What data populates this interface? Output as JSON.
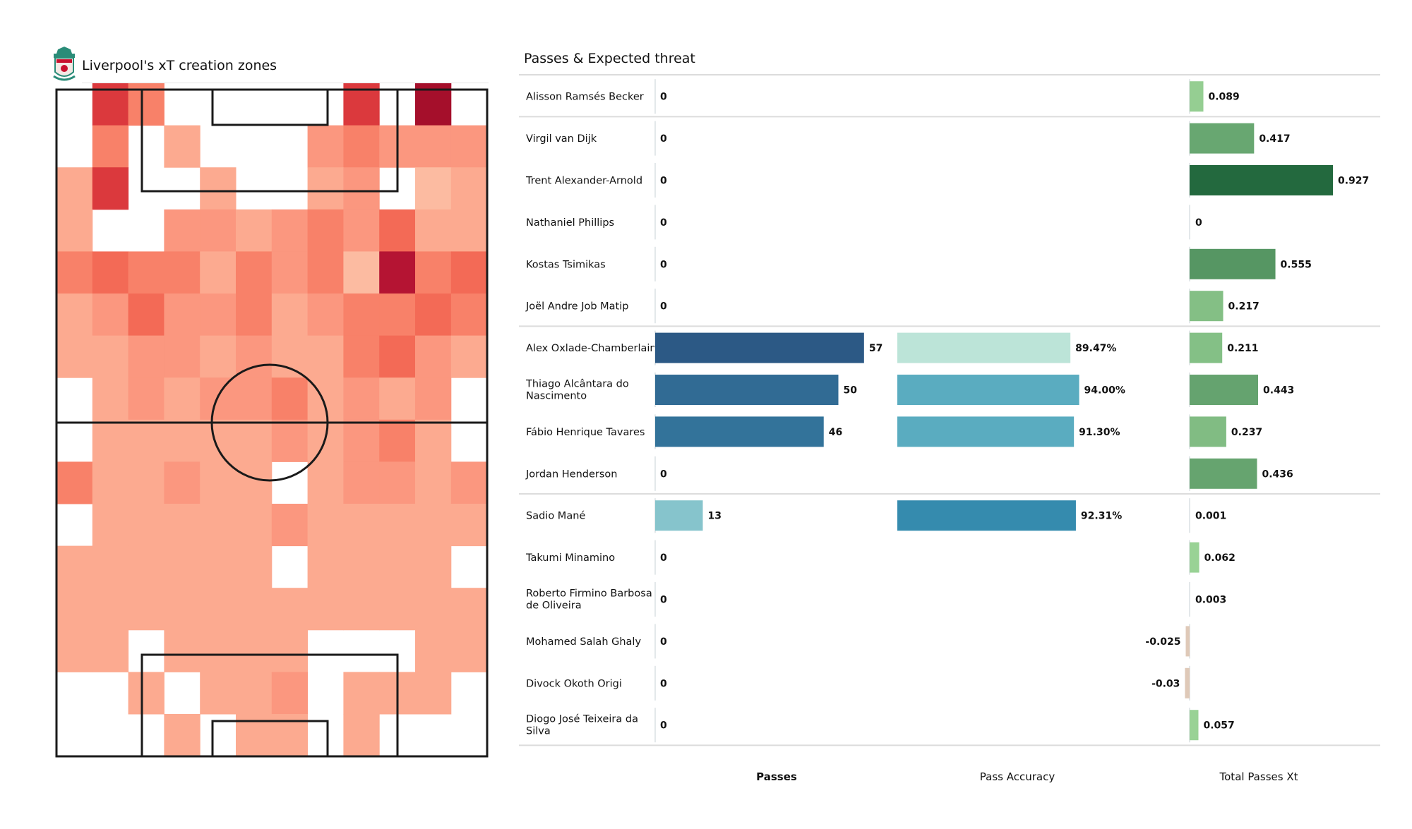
{
  "left": {
    "title": "Liverpool's xT creation zones",
    "logo": "liverpool-crest-icon"
  },
  "right": {
    "title": "Passes & Expected threat",
    "columns": {
      "passes": "Passes",
      "pass_accuracy": "Pass Accuracy",
      "total_xt": "Total Passes Xt"
    }
  },
  "colors": {
    "heat_low": "#fcbba1",
    "heat_high": "#a50f2b",
    "passes_bar_scale": [
      "#86c4cc",
      "#2c5985"
    ],
    "xt_positive_scale": [
      "#a1d99b",
      "#23693e"
    ],
    "xt_negative": "#dfc9b8",
    "separator": "#dcdcdc"
  },
  "chart_data": [
    {
      "type": "heatmap",
      "title": "Liverpool's xT creation zones",
      "description": "Pitch divided into 16 rows (top = attacking goal) x 12 columns; intensity 0 (none) to 10 (highest xT)",
      "rows": 16,
      "cols": 12,
      "values": [
        [
          0,
          7,
          4,
          0,
          0,
          0,
          0,
          0,
          7,
          0,
          10,
          0
        ],
        [
          0,
          4,
          0,
          2,
          0,
          0,
          0,
          3,
          4,
          3,
          3,
          3
        ],
        [
          2,
          7,
          0,
          0,
          2,
          0,
          0,
          2,
          3,
          0,
          1,
          2
        ],
        [
          2,
          0,
          0,
          3,
          3,
          2,
          3,
          4,
          3,
          5,
          2,
          2
        ],
        [
          4,
          5,
          4,
          4,
          2,
          4,
          3,
          4,
          1,
          9,
          4,
          5
        ],
        [
          2,
          3,
          5,
          3,
          3,
          4,
          2,
          3,
          4,
          4,
          5,
          4
        ],
        [
          2,
          2,
          3,
          3,
          2,
          3,
          2,
          2,
          4,
          5,
          3,
          2
        ],
        [
          0,
          2,
          3,
          2,
          3,
          3,
          4,
          2,
          3,
          2,
          3,
          0
        ],
        [
          0,
          2,
          2,
          2,
          2,
          2,
          3,
          2,
          3,
          4,
          2,
          0
        ],
        [
          4,
          2,
          2,
          3,
          2,
          2,
          0,
          2,
          3,
          3,
          2,
          3
        ],
        [
          0,
          2,
          2,
          2,
          2,
          2,
          3,
          2,
          2,
          2,
          2,
          2
        ],
        [
          2,
          2,
          2,
          2,
          2,
          2,
          0,
          2,
          2,
          2,
          2,
          0
        ],
        [
          2,
          2,
          2,
          2,
          2,
          2,
          2,
          2,
          2,
          2,
          2,
          2
        ],
        [
          2,
          2,
          0,
          2,
          2,
          2,
          2,
          0,
          0,
          0,
          2,
          2
        ],
        [
          0,
          0,
          2,
          0,
          2,
          2,
          3,
          0,
          2,
          2,
          2,
          0
        ],
        [
          0,
          0,
          0,
          2,
          0,
          2,
          2,
          0,
          2,
          0,
          0,
          0
        ]
      ]
    },
    {
      "type": "table",
      "title": "Passes & Expected threat",
      "columns": [
        "Player",
        "Passes",
        "Pass Accuracy",
        "Total Passes Xt"
      ],
      "groups": [
        {
          "rows": [
            {
              "player": "Alisson Ramsés Becker",
              "passes": 0,
              "passes_label": "0",
              "accuracy": null,
              "accuracy_label": "",
              "xt": 0.089,
              "xt_label": "0.089"
            }
          ]
        },
        {
          "rows": [
            {
              "player": "Virgil van Dijk",
              "passes": 0,
              "passes_label": "0",
              "accuracy": null,
              "accuracy_label": "",
              "xt": 0.417,
              "xt_label": "0.417"
            },
            {
              "player": "Trent Alexander-Arnold",
              "passes": 0,
              "passes_label": "0",
              "accuracy": null,
              "accuracy_label": "",
              "xt": 0.927,
              "xt_label": "0.927"
            },
            {
              "player": "Nathaniel Phillips",
              "passes": 0,
              "passes_label": "0",
              "accuracy": null,
              "accuracy_label": "",
              "xt": 0,
              "xt_label": "0"
            },
            {
              "player": "Kostas Tsimikas",
              "passes": 0,
              "passes_label": "0",
              "accuracy": null,
              "accuracy_label": "",
              "xt": 0.555,
              "xt_label": "0.555"
            },
            {
              "player": "Joël Andre Job Matip",
              "passes": 0,
              "passes_label": "0",
              "accuracy": null,
              "accuracy_label": "",
              "xt": 0.217,
              "xt_label": "0.217"
            }
          ]
        },
        {
          "rows": [
            {
              "player": "Alex Oxlade-Chamberlain",
              "passes": 57,
              "passes_label": "57",
              "accuracy": 89.47,
              "accuracy_label": "89.47%",
              "xt": 0.211,
              "xt_label": "0.211"
            },
            {
              "player": "Thiago Alcântara do Nascimento",
              "passes": 50,
              "passes_label": "50",
              "accuracy": 94.0,
              "accuracy_label": "94.00%",
              "xt": 0.443,
              "xt_label": "0.443"
            },
            {
              "player": "Fábio Henrique Tavares",
              "passes": 46,
              "passes_label": "46",
              "accuracy": 91.3,
              "accuracy_label": "91.30%",
              "xt": 0.237,
              "xt_label": "0.237"
            },
            {
              "player": "Jordan Henderson",
              "passes": 0,
              "passes_label": "0",
              "accuracy": null,
              "accuracy_label": "",
              "xt": 0.436,
              "xt_label": "0.436"
            }
          ]
        },
        {
          "rows": [
            {
              "player": "Sadio Mané",
              "passes": 13,
              "passes_label": "13",
              "accuracy": 92.31,
              "accuracy_label": "92.31%",
              "xt": 0.001,
              "xt_label": "0.001"
            },
            {
              "player": "Takumi Minamino",
              "passes": 0,
              "passes_label": "0",
              "accuracy": null,
              "accuracy_label": "",
              "xt": 0.062,
              "xt_label": "0.062"
            },
            {
              "player": "Roberto Firmino Barbosa de Oliveira",
              "passes": 0,
              "passes_label": "0",
              "accuracy": null,
              "accuracy_label": "",
              "xt": 0.003,
              "xt_label": "0.003"
            },
            {
              "player": "Mohamed  Salah Ghaly",
              "passes": 0,
              "passes_label": "0",
              "accuracy": null,
              "accuracy_label": "",
              "xt": -0.025,
              "xt_label": "-0.025"
            },
            {
              "player": "Divock Okoth Origi",
              "passes": 0,
              "passes_label": "0",
              "accuracy": null,
              "accuracy_label": "",
              "xt": -0.03,
              "xt_label": "-0.03"
            },
            {
              "player": "Diogo José Teixeira da Silva",
              "passes": 0,
              "passes_label": "0",
              "accuracy": null,
              "accuracy_label": "",
              "xt": 0.057,
              "xt_label": "0.057"
            }
          ]
        }
      ],
      "accuracy_colors": {
        "89.47": "#bce4d8",
        "94.0": "#2c5985",
        "91.3": "#5aacc0",
        "92.31": "#358bae"
      },
      "passes_colors": {
        "57": "#2c5985",
        "50": "#316b94",
        "46": "#33739a",
        "13": "#86c4cc"
      }
    }
  ]
}
